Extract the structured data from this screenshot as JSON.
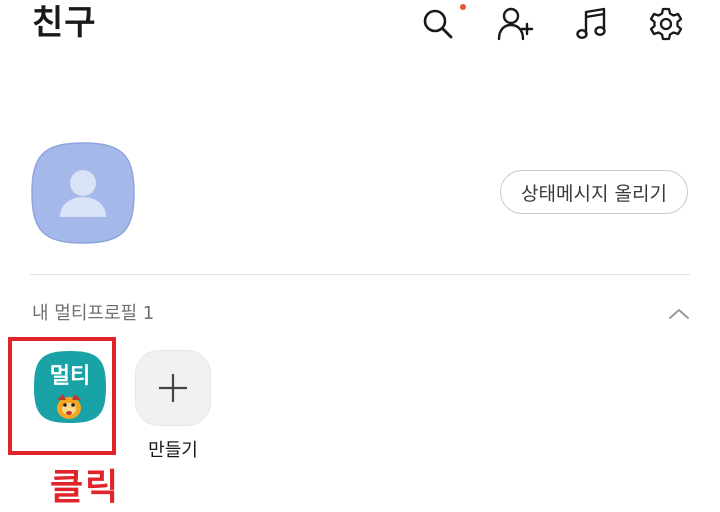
{
  "header": {
    "title": "친구",
    "notification_dot_color": "#e8552f",
    "icons": [
      "search-icon",
      "add-friend-icon",
      "music-icon",
      "settings-icon"
    ]
  },
  "profile": {
    "avatar_color": "#a4b8ea",
    "status_button_label": "상태메시지 올리기"
  },
  "multi_profile": {
    "section_label": "내 멀티프로필 1",
    "items": [
      {
        "label": "멀티",
        "tile_color": "#1aa3a6"
      }
    ],
    "create_label": "만들기"
  },
  "annotation": {
    "text": "클릭",
    "color": "#e1242a"
  }
}
